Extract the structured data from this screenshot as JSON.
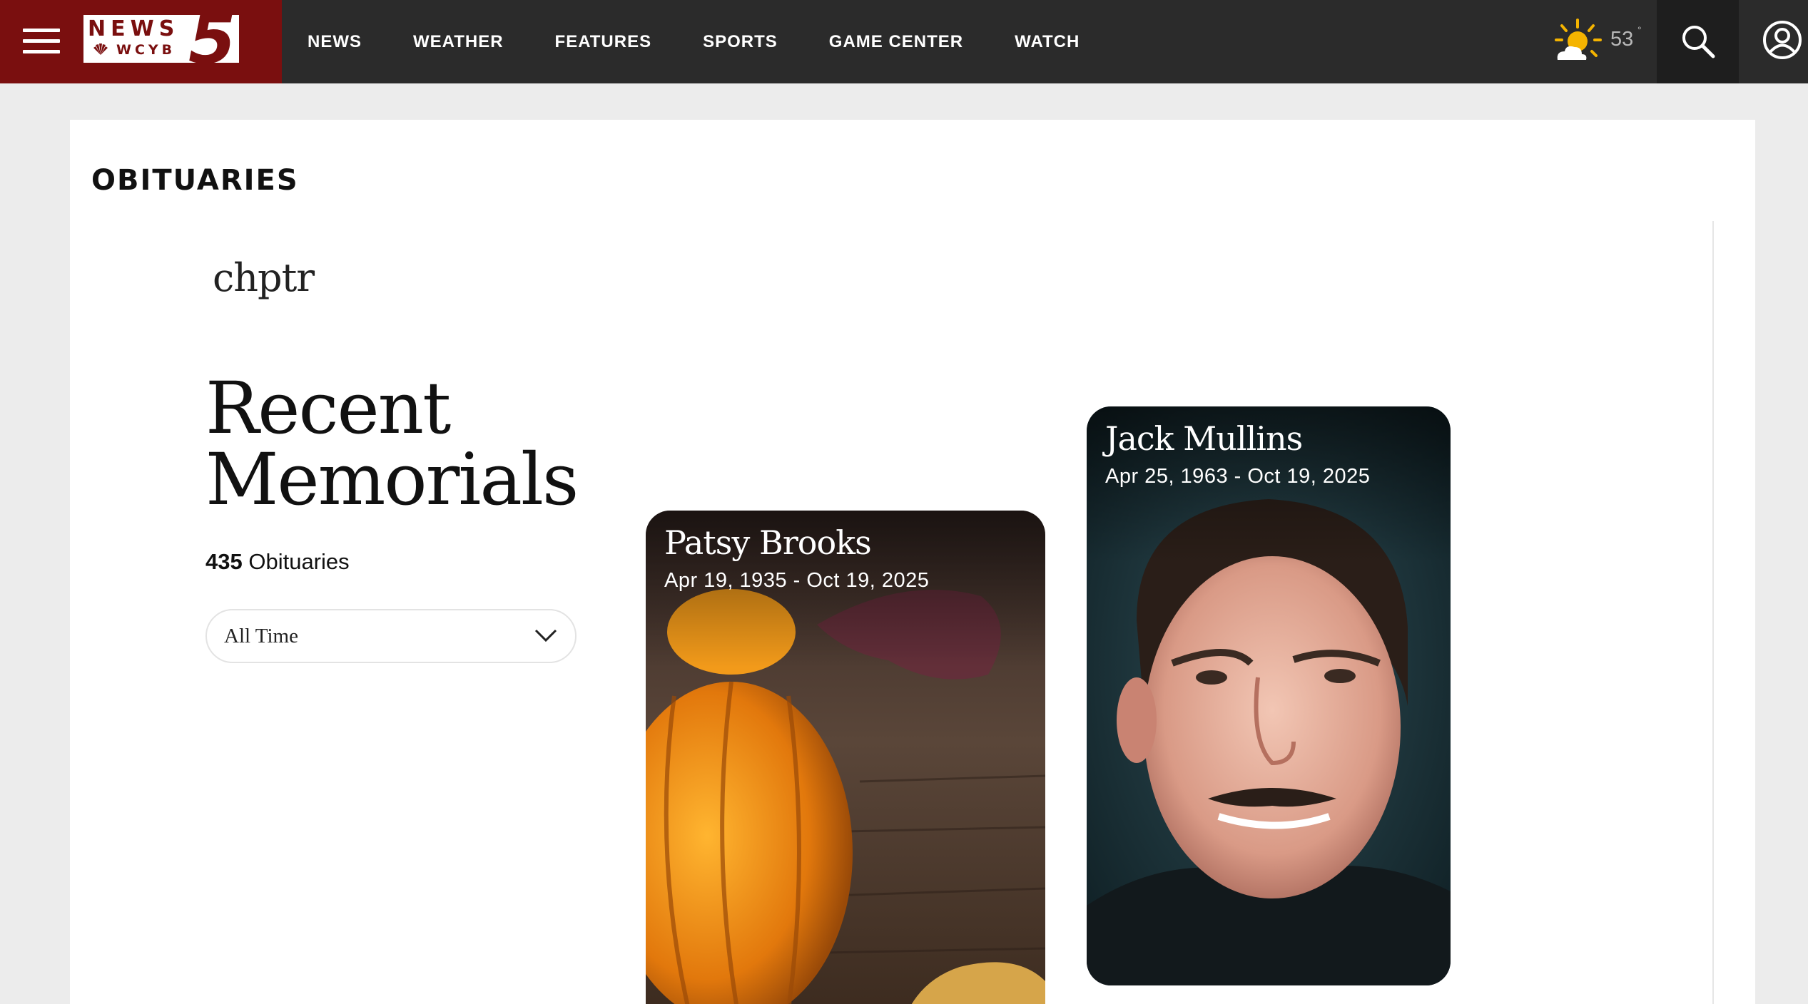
{
  "site": {
    "logo_top": "NEWS",
    "logo_call": "WCYB",
    "logo_number": "5"
  },
  "nav": {
    "items": [
      {
        "label": "NEWS"
      },
      {
        "label": "WEATHER"
      },
      {
        "label": "FEATURES"
      },
      {
        "label": "SPORTS"
      },
      {
        "label": "GAME CENTER"
      },
      {
        "label": "WATCH"
      }
    ]
  },
  "weather": {
    "temperature": "53",
    "degree_symbol": "°",
    "icon": "partly-sunny-icon"
  },
  "icons": {
    "menu": "hamburger-menu-icon",
    "search": "search-icon",
    "account": "account-icon",
    "filter": "chevron-down-icon"
  },
  "page": {
    "section_title": "OBITUARIES",
    "partner_brand": "chptr",
    "heading_line1": "Recent",
    "heading_line2": "Memorials",
    "count_value": "435",
    "count_label": " Obituaries",
    "filter_selected": "All Time"
  },
  "memorials": [
    {
      "name": "Patsy Brooks",
      "dates": "Apr 19, 1935 - Oct 19, 2025"
    },
    {
      "name": "Jack Mullins",
      "dates": "Apr 25, 1963 - Oct 19, 2025"
    }
  ],
  "colors": {
    "brand_red": "#7a0f0f",
    "nav_bg": "#2b2b2b",
    "page_bg": "#ececec"
  }
}
